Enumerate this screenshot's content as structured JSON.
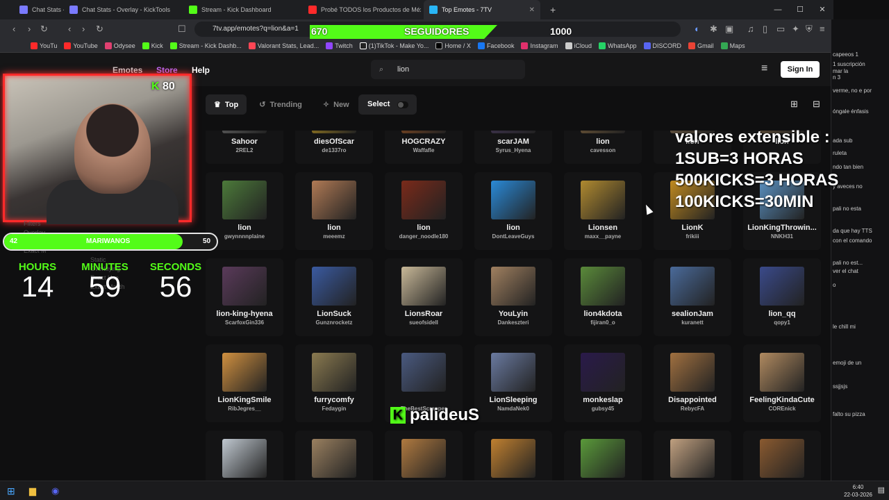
{
  "browser": {
    "tabs": [
      {
        "label": "Chat Stats - O",
        "color": "#7a7aff"
      },
      {
        "label": "Chat Stats - Overlay - KickTools",
        "color": "#7a7aff"
      },
      {
        "label": "Stream - Kick Dashboard",
        "color": "#53fc18"
      },
      {
        "label": "Probé TODOS los Productos de Méx",
        "color": "#ff2a2a"
      },
      {
        "label": "Top Emotes - 7TV",
        "color": "#29b6f6"
      }
    ],
    "url": "7tv.app/emotes?q=lion&a=1",
    "bookmarks": [
      "YouTu",
      "YouTube",
      "Odysee",
      "Kick",
      "Stream - Kick Dashb...",
      "Valorant Stats, Lead...",
      "Twitch",
      "(1)TikTok - Make Yo...",
      "Home / X",
      "Facebook",
      "Instagram",
      "iCloud",
      "WhatsApp",
      "DISCORD",
      "Gmail",
      "Maps"
    ]
  },
  "site": {
    "nav": {
      "emotes": "Emotes",
      "store": "Store",
      "help": "Help"
    },
    "search_value": "lion",
    "signin": "Sign In",
    "filters": {
      "top": "Top",
      "trending": "Trending",
      "new": "New",
      "select": "Select"
    }
  },
  "emotes": [
    {
      "name": "Sahoor",
      "author": "2REL2",
      "color": "#777"
    },
    {
      "name": "diesOfScar",
      "author": "de1337ro",
      "color": "#c9a020"
    },
    {
      "name": "HOGCRAZY",
      "author": "Waffafle",
      "color": "#a05520"
    },
    {
      "name": "scarJAM",
      "author": "Syrus_Hyena",
      "color": "#4a3a60"
    },
    {
      "name": "lion",
      "author": "cavesson",
      "color": "#8a6a40"
    },
    {
      "name": "lion",
      "author": "",
      "color": "#8a7050"
    },
    {
      "name": "lion",
      "author": "",
      "color": "#7a6040"
    },
    {
      "name": "lion",
      "author": "gwynnnnplaine",
      "color": "#4c7a3a"
    },
    {
      "name": "lion",
      "author": "meeemz",
      "color": "#b07a55"
    },
    {
      "name": "lion",
      "author": "danger_noodle180",
      "color": "#7a2a1a"
    },
    {
      "name": "lion",
      "author": "DontLeaveGuys",
      "color": "#2a8ad8"
    },
    {
      "name": "Lionsen",
      "author": "maxx__payne",
      "color": "#b08a30"
    },
    {
      "name": "LionK",
      "author": "frikiii",
      "color": "#c08a20"
    },
    {
      "name": "LionKingThrowin...",
      "author": "NNKH31",
      "color": "#5a90c0"
    },
    {
      "name": "lion-king-hyena",
      "author": "ScarfoxGin336",
      "color": "#5a3a5a"
    },
    {
      "name": "LionSuck",
      "author": "Gunznrocketz",
      "color": "#3a5aa0"
    },
    {
      "name": "LionsRoar",
      "author": "sueofsidell",
      "color": "#c8b898"
    },
    {
      "name": "YouLyin",
      "author": "Dankeszteri",
      "color": "#a08060"
    },
    {
      "name": "lion4kdota",
      "author": "fijiran0_o",
      "color": "#5a8a3a"
    },
    {
      "name": "sealionJam",
      "author": "kuranett",
      "color": "#4a6a9a"
    },
    {
      "name": "lion_qq",
      "author": "qopy1",
      "color": "#3a4a8a"
    },
    {
      "name": "LionKingSmile",
      "author": "RibJegres__",
      "color": "#d09040"
    },
    {
      "name": "furrycomfy",
      "author": "Fedaygin",
      "color": "#8a7a50"
    },
    {
      "name": "",
      "author": "TheBestScrapper",
      "color": "#4a5a80"
    },
    {
      "name": "LionSleeping",
      "author": "NamdaNek0",
      "color": "#6a7aa0"
    },
    {
      "name": "monkeslap",
      "author": "gubsy45",
      "color": "#2a1a4a"
    },
    {
      "name": "Disappointed",
      "author": "RebycFA",
      "color": "#a07040"
    },
    {
      "name": "FeelingKindaCute",
      "author": "COREnick",
      "color": "#b08a60"
    },
    {
      "name": "",
      "author": "",
      "color": "#c0c8d0"
    },
    {
      "name": "",
      "author": "",
      "color": "#9a8060"
    },
    {
      "name": "",
      "author": "",
      "color": "#b07a40"
    },
    {
      "name": "",
      "author": "",
      "color": "#c08030"
    },
    {
      "name": "",
      "author": "",
      "color": "#5a9a3a"
    },
    {
      "name": "",
      "author": "",
      "color": "#c0a080"
    },
    {
      "name": "",
      "author": "",
      "color": "#8a5a30"
    }
  ],
  "overlay": {
    "followers_start": "670",
    "followers_label": "SEGUIDORES",
    "followers_goal": "1000",
    "followers_progress": 0.67,
    "kick_badge": "80",
    "mariwanos_label": "MARIWANOS",
    "mariwanos_current": "42",
    "mariwanos_goal": "50",
    "mariwanos_progress": 0.84,
    "hours_label": "HOURS",
    "minutes_label": "MINUTES",
    "seconds_label": "SECONDS",
    "hours": "14",
    "minutes": "59",
    "seconds": "56",
    "valores": [
      "valores extensible :",
      "1SUB=3 HORAS",
      "500KICKS=3 HORAS",
      "100KICKS=30MIN"
    ],
    "streamer": "palideuS",
    "ghost_filters": [
      "Filters",
      "Overlay",
      "Person",
      "Exact M",
      "Static",
      "Overlaying",
      "Exact Use",
      "Exact Match"
    ]
  },
  "chat": {
    "lines": [
      "capeeos 1",
      "1 suscripción",
      "mar la",
      "n 3",
      "verme, no e por",
      "óngale énfasis",
      "ada sub",
      "ruleta",
      "ndo tan bien",
      "y aveces no",
      "pali no esta",
      "da que hay TTS",
      "con el comando",
      "pali no est...",
      "ver el chat",
      "o",
      "le chill mi",
      "emoji de un",
      "ssjjsjs",
      "falto su pizza"
    ]
  },
  "taskbar": {
    "time": "6:40",
    "date": "22-03-2026"
  }
}
